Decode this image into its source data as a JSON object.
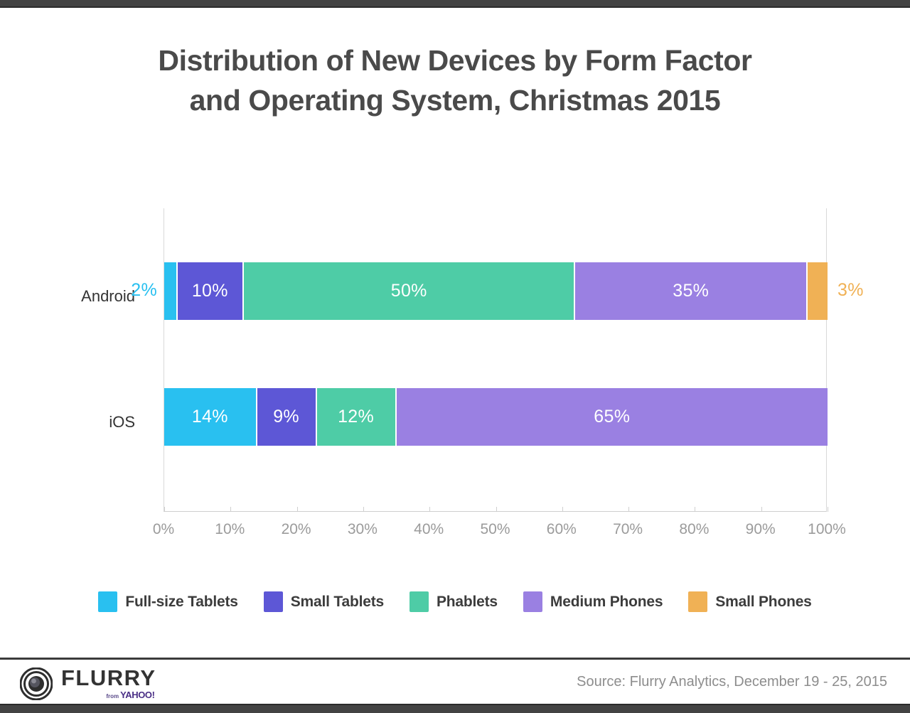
{
  "chrome": {
    "top_bar_color": "#434343",
    "bottom_bar_color": "#434343"
  },
  "title": {
    "line1": "Distribution of New Devices by Form Factor",
    "line2": "and Operating System, Christmas 2015"
  },
  "footer": {
    "logo_word": "FLURRY",
    "logo_from": "from",
    "logo_yahoo": "YAHOO!",
    "source": "Source: Flurry Analytics, December 19 - 25, 2015"
  },
  "chart_data": {
    "type": "bar",
    "orientation": "horizontal",
    "stacked": true,
    "normalized_percent": true,
    "title": "Distribution of New Devices by Form Factor and Operating System, Christmas 2015",
    "xlabel": "",
    "ylabel": "",
    "xlim": [
      0,
      100
    ],
    "xticks": [
      "0%",
      "10%",
      "20%",
      "30%",
      "40%",
      "50%",
      "60%",
      "70%",
      "80%",
      "90%",
      "100%"
    ],
    "xtick_values": [
      0,
      10,
      20,
      30,
      40,
      50,
      60,
      70,
      80,
      90,
      100
    ],
    "grid": false,
    "legend_position": "bottom",
    "categories": [
      "Android",
      "iOS"
    ],
    "series": [
      {
        "name": "Full-size Tablets",
        "color": "#29c0f0",
        "values": [
          2,
          14
        ],
        "labels": [
          "2%",
          "14%"
        ],
        "label_inside": [
          false,
          true
        ]
      },
      {
        "name": "Small Tablets",
        "color": "#5d57d6",
        "values": [
          10,
          9
        ],
        "labels": [
          "10%",
          "9%"
        ],
        "label_inside": [
          true,
          true
        ]
      },
      {
        "name": "Phablets",
        "color": "#4ecca6",
        "values": [
          50,
          12
        ],
        "labels": [
          "50%",
          "12%"
        ],
        "label_inside": [
          true,
          true
        ]
      },
      {
        "name": "Medium Phones",
        "color": "#9a80e2",
        "values": [
          35,
          65
        ],
        "labels": [
          "35%",
          "65%"
        ],
        "label_inside": [
          true,
          true
        ]
      },
      {
        "name": "Small Phones",
        "color": "#f0b155",
        "values": [
          3,
          0
        ],
        "labels": [
          "3%",
          ""
        ],
        "label_inside": [
          false,
          false
        ]
      }
    ]
  }
}
